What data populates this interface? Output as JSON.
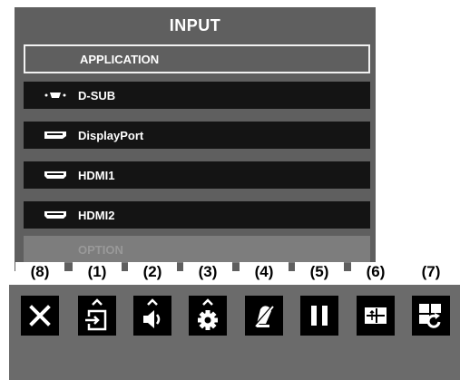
{
  "menu": {
    "title": "INPUT",
    "items": [
      {
        "label": "APPLICATION",
        "icon": "none"
      },
      {
        "label": "D-SUB",
        "icon": "dsub-port-icon"
      },
      {
        "label": "DisplayPort",
        "icon": "displayport-icon"
      },
      {
        "label": "HDMI1",
        "icon": "hdmi-port-icon"
      },
      {
        "label": "HDMI2",
        "icon": "hdmi-port-icon"
      },
      {
        "label": "OPTION",
        "icon": "none"
      }
    ]
  },
  "toolbar": {
    "buttons": [
      {
        "number": "(8)",
        "icon": "close-icon"
      },
      {
        "number": "(1)",
        "icon": "input-select-icon"
      },
      {
        "number": "(2)",
        "icon": "volume-icon"
      },
      {
        "number": "(3)",
        "icon": "settings-gear-icon"
      },
      {
        "number": "(4)",
        "icon": "mute-off-icon"
      },
      {
        "number": "(5)",
        "icon": "pause-icon"
      },
      {
        "number": "(6)",
        "icon": "pip-swap-icon"
      },
      {
        "number": "(7)",
        "icon": "window-rotate-icon"
      }
    ]
  },
  "colors": {
    "menu_bg": "#5f5f5f",
    "row_bg": "#141414",
    "option_bg": "#7d7d7d",
    "toolbar_bg": "#6b6b6b",
    "button_bg": "#000000"
  }
}
